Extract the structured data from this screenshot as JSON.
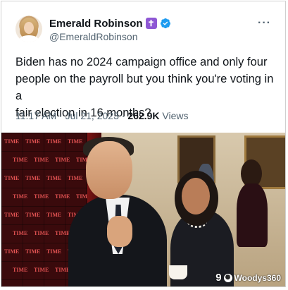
{
  "tweet": {
    "display_name": "Emerald Robinson",
    "handle": "@EmeraldRobinson",
    "cross_badge": "✝",
    "more_icon": "ellipsis-icon",
    "text": "Biden has no 2024 campaign office and only four\npeople on the payroll but you think you're voting in a\nfair election in 16 months?",
    "time": "11:17 AM",
    "separator": "·",
    "date": "Jul 21, 2023",
    "views_count": "262.9K",
    "views_label": "Views"
  },
  "backdrop_logo": "TIME",
  "watermark": {
    "prefix": "9",
    "badge": "⚈",
    "name": "Woodys360"
  },
  "colors": {
    "verified": "#1d9bf0",
    "cross_badge": "#8e57d4",
    "muted_text": "#536471"
  }
}
